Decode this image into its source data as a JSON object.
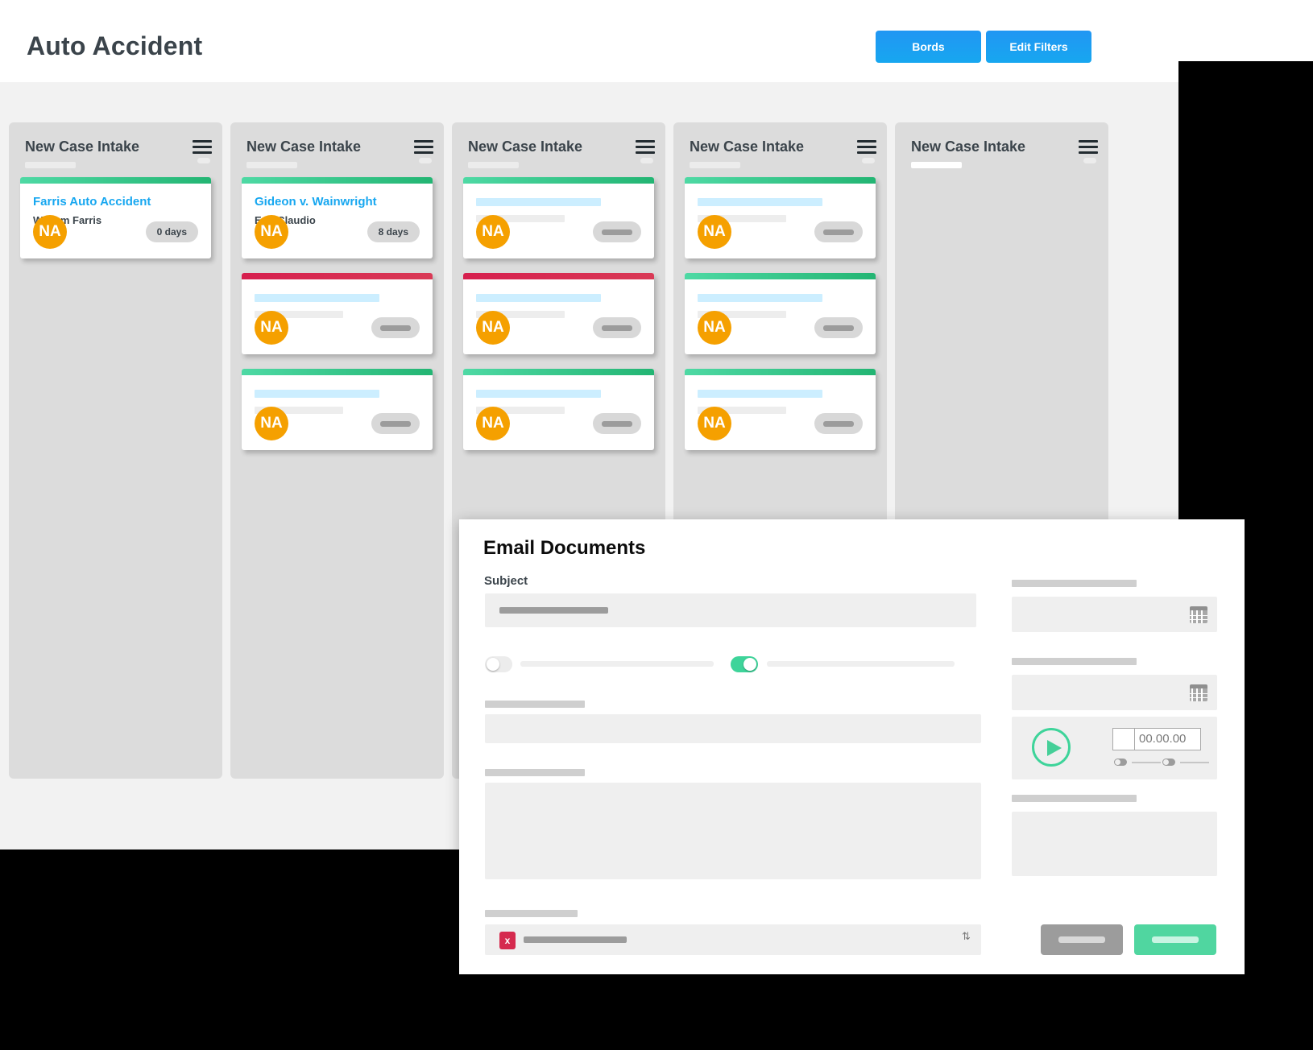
{
  "header": {
    "title": "Auto Accident",
    "buttons": [
      {
        "name": "bords",
        "label": "Bords"
      },
      {
        "name": "edit-filters",
        "label": "Edit Filters"
      }
    ]
  },
  "board": {
    "columns": [
      {
        "title": "New Case Intake",
        "menu_icon": "hamburger-icon",
        "cards": [
          {
            "accent": "green",
            "title": "Farris Auto Accident",
            "subtitle": "William Farris",
            "avatar": "NA",
            "badge": "0 days",
            "placeholder": false
          }
        ]
      },
      {
        "title": "New Case Intake",
        "menu_icon": "hamburger-icon",
        "cards": [
          {
            "accent": "green",
            "title": "Gideon v. Wainwright",
            "subtitle": "Eric Claudio",
            "avatar": "NA",
            "badge": "8 days",
            "placeholder": false
          },
          {
            "accent": "red",
            "title": "",
            "subtitle": "",
            "avatar": "NA",
            "badge": "",
            "placeholder": true
          },
          {
            "accent": "green",
            "title": "",
            "subtitle": "",
            "avatar": "NA",
            "badge": "",
            "placeholder": true
          }
        ]
      },
      {
        "title": "New Case Intake",
        "menu_icon": "hamburger-icon",
        "cards": [
          {
            "accent": "green",
            "title": "",
            "subtitle": "",
            "avatar": "NA",
            "badge": "",
            "placeholder": true
          },
          {
            "accent": "red",
            "title": "",
            "subtitle": "",
            "avatar": "NA",
            "badge": "",
            "placeholder": true
          },
          {
            "accent": "green",
            "title": "",
            "subtitle": "",
            "avatar": "NA",
            "badge": "",
            "placeholder": true
          }
        ]
      },
      {
        "title": "New Case Intake",
        "menu_icon": "hamburger-icon",
        "cards": [
          {
            "accent": "green",
            "title": "",
            "subtitle": "",
            "avatar": "NA",
            "badge": "",
            "placeholder": true
          },
          {
            "accent": "green",
            "title": "",
            "subtitle": "",
            "avatar": "NA",
            "badge": "",
            "placeholder": true
          },
          {
            "accent": "green",
            "title": "",
            "subtitle": "",
            "avatar": "NA",
            "badge": "",
            "placeholder": true
          }
        ]
      },
      {
        "title": "New Case Intake",
        "menu_icon": "hamburger-icon",
        "cards": []
      }
    ]
  },
  "modal": {
    "title": "Email Documents",
    "subject_label": "Subject",
    "subject_value": "",
    "toggles": [
      {
        "name": "toggle-left",
        "state": "off"
      },
      {
        "name": "toggle-right",
        "state": "on"
      }
    ],
    "player": {
      "play_icon": "play-icon",
      "time": "00.00.00"
    },
    "attachment": {
      "icon": "remove-attachment-icon",
      "icon_glyph": "x",
      "caret_icon": "sort-caret-icon",
      "caret_glyph": "⇅"
    },
    "date_fields": [
      {
        "name": "date-field-1",
        "icon": "calendar-icon"
      },
      {
        "name": "date-field-2",
        "icon": "calendar-icon"
      }
    ],
    "buttons": [
      {
        "name": "cancel",
        "label": ""
      },
      {
        "name": "submit",
        "label": ""
      }
    ]
  },
  "colors": {
    "accent_blue": "#17a7f0",
    "accent_green": "#3ed49a",
    "accent_red": "#d52a4e",
    "avatar_orange": "#f5a000",
    "board_bg": "#f2f2f2",
    "column_bg": "#dcdcdc"
  }
}
